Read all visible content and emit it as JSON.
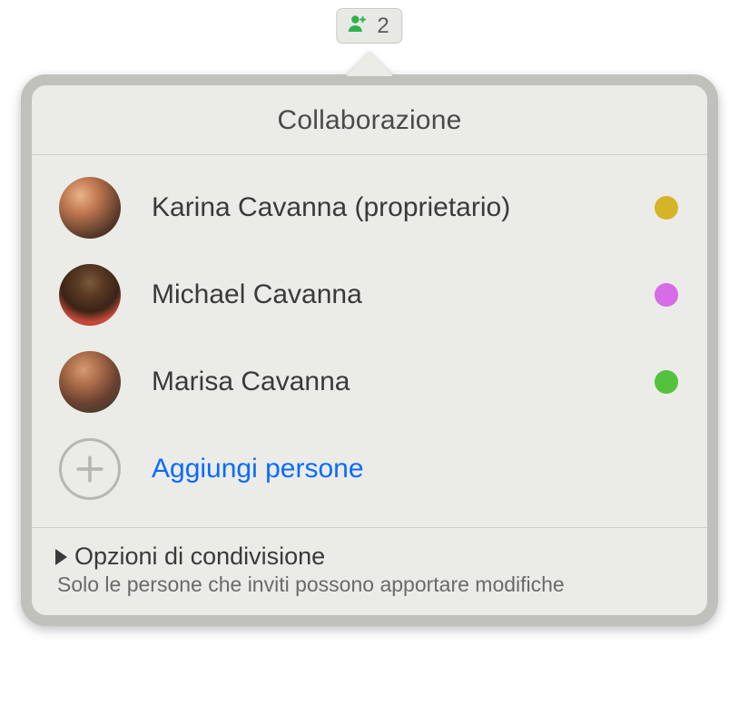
{
  "toolbar": {
    "count": "2"
  },
  "popover": {
    "title": "Collaborazione",
    "participants": [
      {
        "name": "Karina Cavanna (proprietario)",
        "color": "#d6b427"
      },
      {
        "name": "Michael Cavanna",
        "color": "#d86be6"
      },
      {
        "name": "Marisa Cavanna",
        "color": "#55c23e"
      }
    ],
    "add_label": "Aggiungi persone",
    "options": {
      "title": "Opzioni di condivisione",
      "subtitle": "Solo le persone che inviti possono apportare modifiche"
    }
  }
}
